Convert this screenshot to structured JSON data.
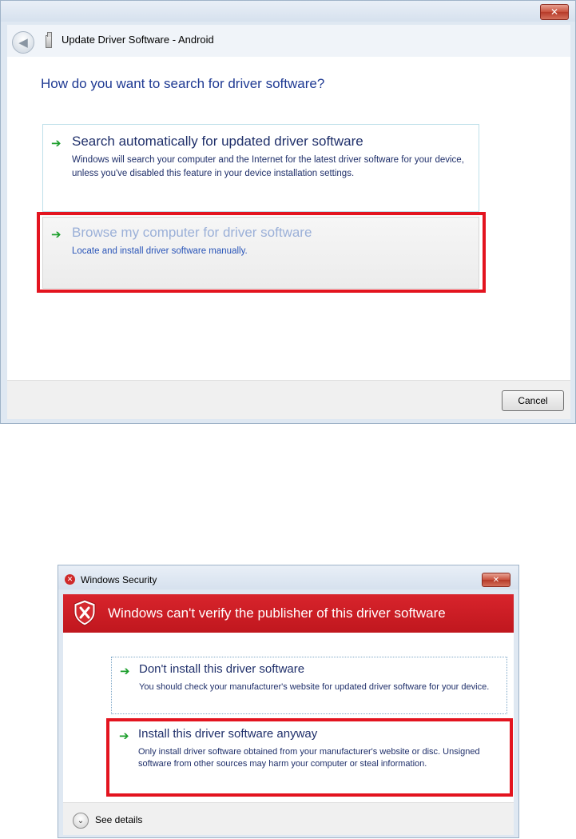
{
  "update_driver_window": {
    "close_glyph": "✕",
    "back_glyph": "◀",
    "title": "Update Driver Software - Android",
    "instruction": "How do you want to search for driver software?",
    "options": [
      {
        "arrow": "➔",
        "title": "Search automatically for updated driver software",
        "description": "Windows will search your computer and the Internet for the latest driver software for your device, unless you've disabled this feature in your device installation settings."
      },
      {
        "arrow": "➔",
        "title": "Browse my computer for driver software",
        "description": "Locate and install driver software manually."
      }
    ],
    "cancel_label": "Cancel"
  },
  "security_window": {
    "title_icon_glyph": "✕",
    "title": "Windows Security",
    "close_glyph": "✕",
    "banner": "Windows can't verify the publisher of this driver software",
    "options": [
      {
        "arrow": "➔",
        "title": "Don't install this driver software",
        "description": "You should check your manufacturer's website for updated driver software for your device."
      },
      {
        "arrow": "➔",
        "title": "Install this driver software anyway",
        "description": "Only install driver software obtained from your manufacturer's website or disc. Unsigned software from other sources may harm your computer or steal information."
      }
    ],
    "chevron_glyph": "⌄",
    "see_details": "See details"
  },
  "colors": {
    "highlight": "#e3141f",
    "banner": "#c0171e",
    "arrow": "#1a9e2a",
    "link_text": "#1f3a93"
  }
}
